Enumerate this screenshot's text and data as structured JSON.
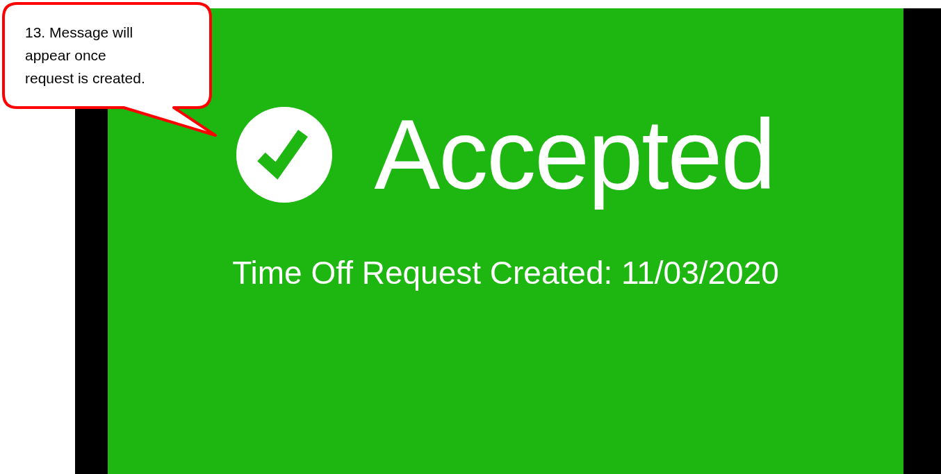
{
  "callout": {
    "text": "13. Message will appear once request is created."
  },
  "status": {
    "title": "Accepted",
    "message": "Time Off Request Created: 11/03/2020"
  }
}
